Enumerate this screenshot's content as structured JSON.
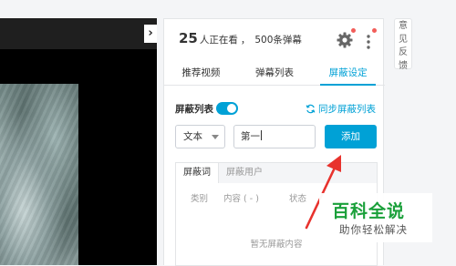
{
  "header": {
    "viewer_count": "25",
    "viewer_text": "人正在看",
    "separator": "，",
    "danmaku_count_text": "500条弹幕"
  },
  "icons": {
    "settings": "gear-icon",
    "more": "more-vertical-icon",
    "sync": "sync-icon"
  },
  "tabs": [
    {
      "label": "推荐视频",
      "active": false
    },
    {
      "label": "弹幕列表",
      "active": false
    },
    {
      "label": "屏蔽设定",
      "active": true
    }
  ],
  "block_settings": {
    "list_label": "屏蔽列表",
    "toggle_on": true,
    "sync_label": "同步屏蔽列表",
    "type_select": "文本",
    "input_value": "第一",
    "add_button": "添加"
  },
  "sub_tabs": [
    {
      "label": "屏蔽词",
      "active": true
    },
    {
      "label": "屏蔽用户",
      "active": false
    }
  ],
  "table": {
    "columns": [
      "类别",
      "内容 ( - )",
      "状态"
    ],
    "empty_text": "暂无屏蔽内容"
  },
  "side": {
    "feedback_chars": [
      "意",
      "见",
      "反",
      "馈"
    ]
  },
  "watermark": {
    "title": "百科全说",
    "subtitle": "助你轻松解决"
  },
  "colors": {
    "accent": "#00a1d6",
    "notify_dot": "#f25d59",
    "arrow": "#e8322d",
    "watermark_green": "#1aa03a"
  }
}
